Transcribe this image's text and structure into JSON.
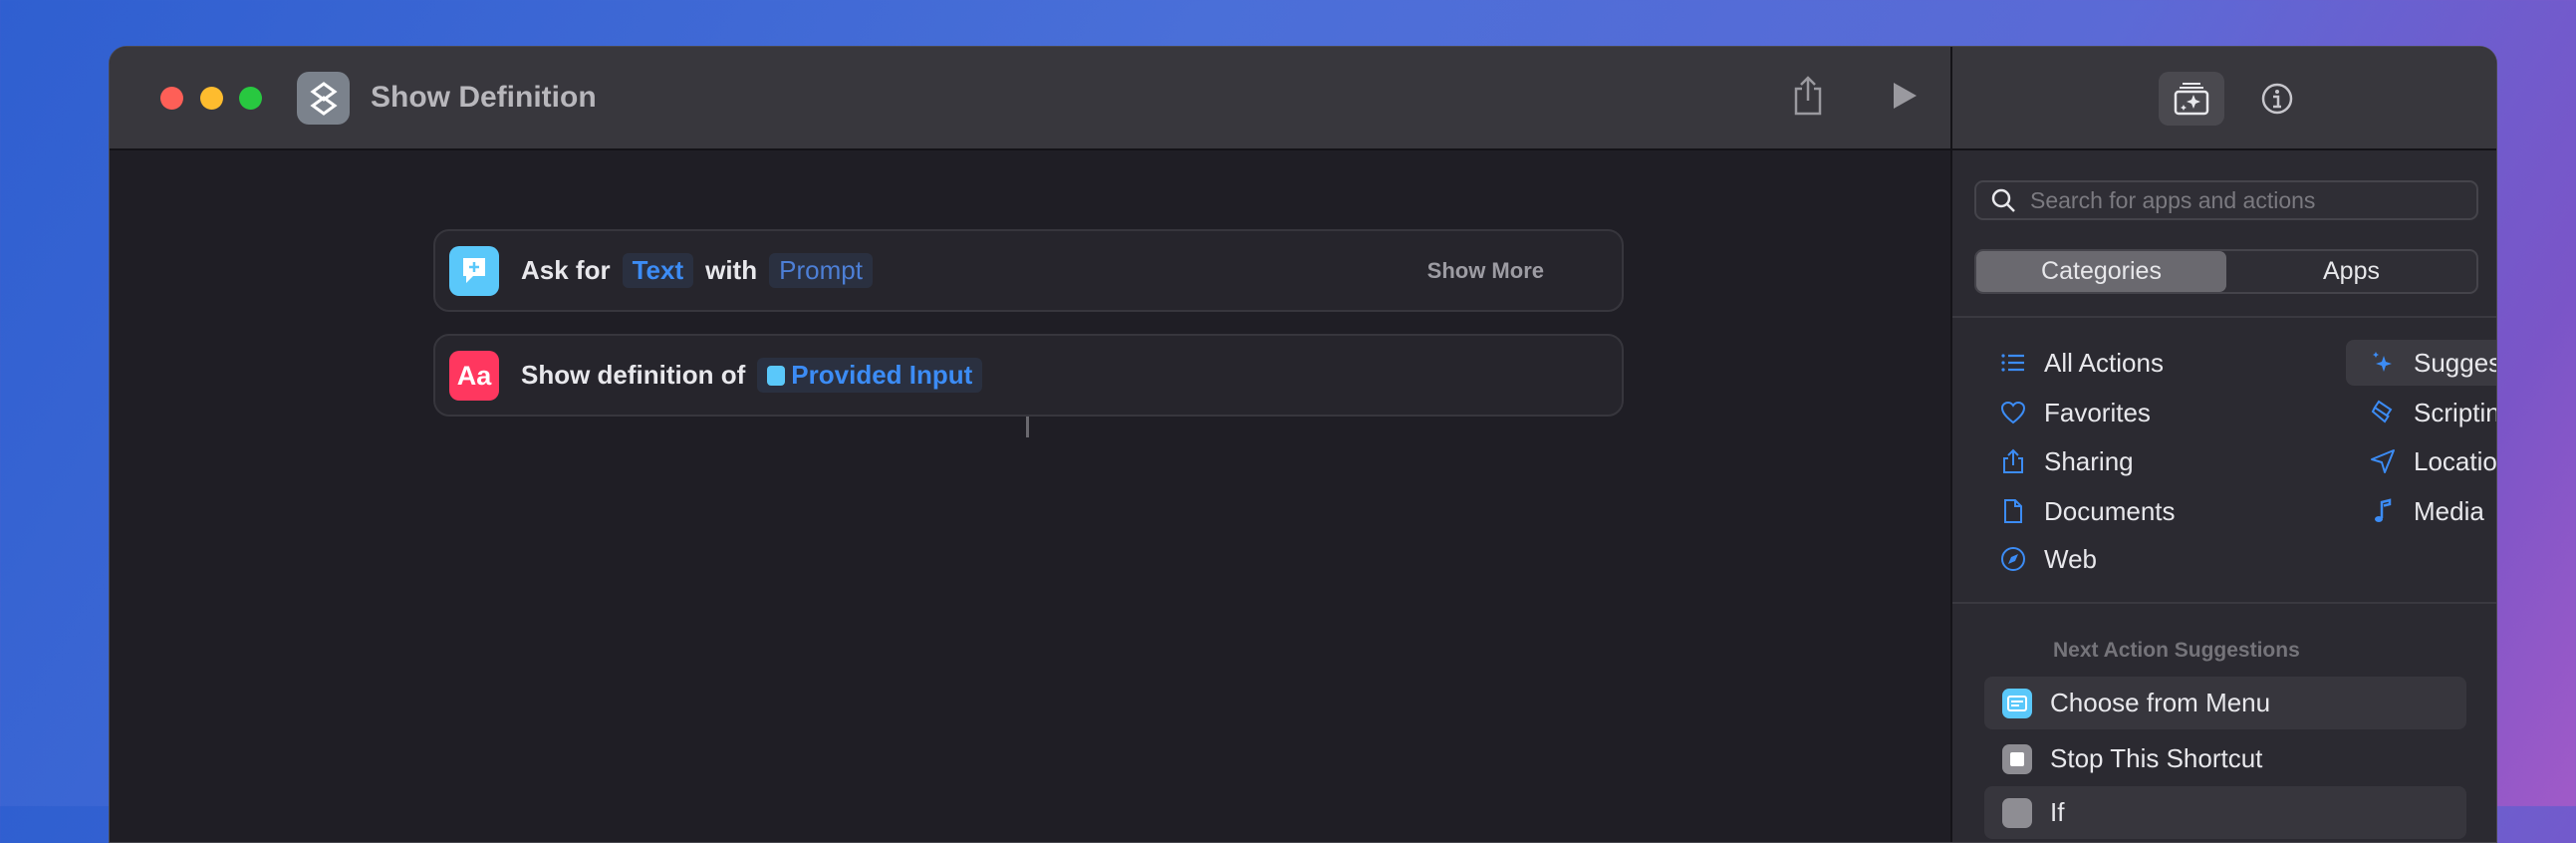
{
  "window": {
    "title": "Show Definition"
  },
  "actions": [
    {
      "icon": "ask-for-input-icon",
      "color": "#5ac8fa",
      "prefix": "Ask for",
      "param1": "Text",
      "middle": "with",
      "param2": "Prompt",
      "show_more": "Show More"
    },
    {
      "icon": "dictionary-icon",
      "icon_text": "Aa",
      "color": "#ff375f",
      "prefix": "Show definition of",
      "param1": "Provided Input"
    }
  ],
  "sidebar": {
    "search_placeholder": "Search for apps and actions",
    "segments": [
      "Categories",
      "Apps"
    ],
    "categories_left": [
      "All Actions",
      "Favorites",
      "Sharing",
      "Documents",
      "Web"
    ],
    "categories_right": [
      "Suggestions",
      "Scripting",
      "Location",
      "Media"
    ],
    "next_header": "Next Action Suggestions",
    "suggestions": [
      "Choose from Menu",
      "Stop This Shortcut",
      "If"
    ]
  },
  "colors": {
    "accent": "#3c8cf5"
  }
}
